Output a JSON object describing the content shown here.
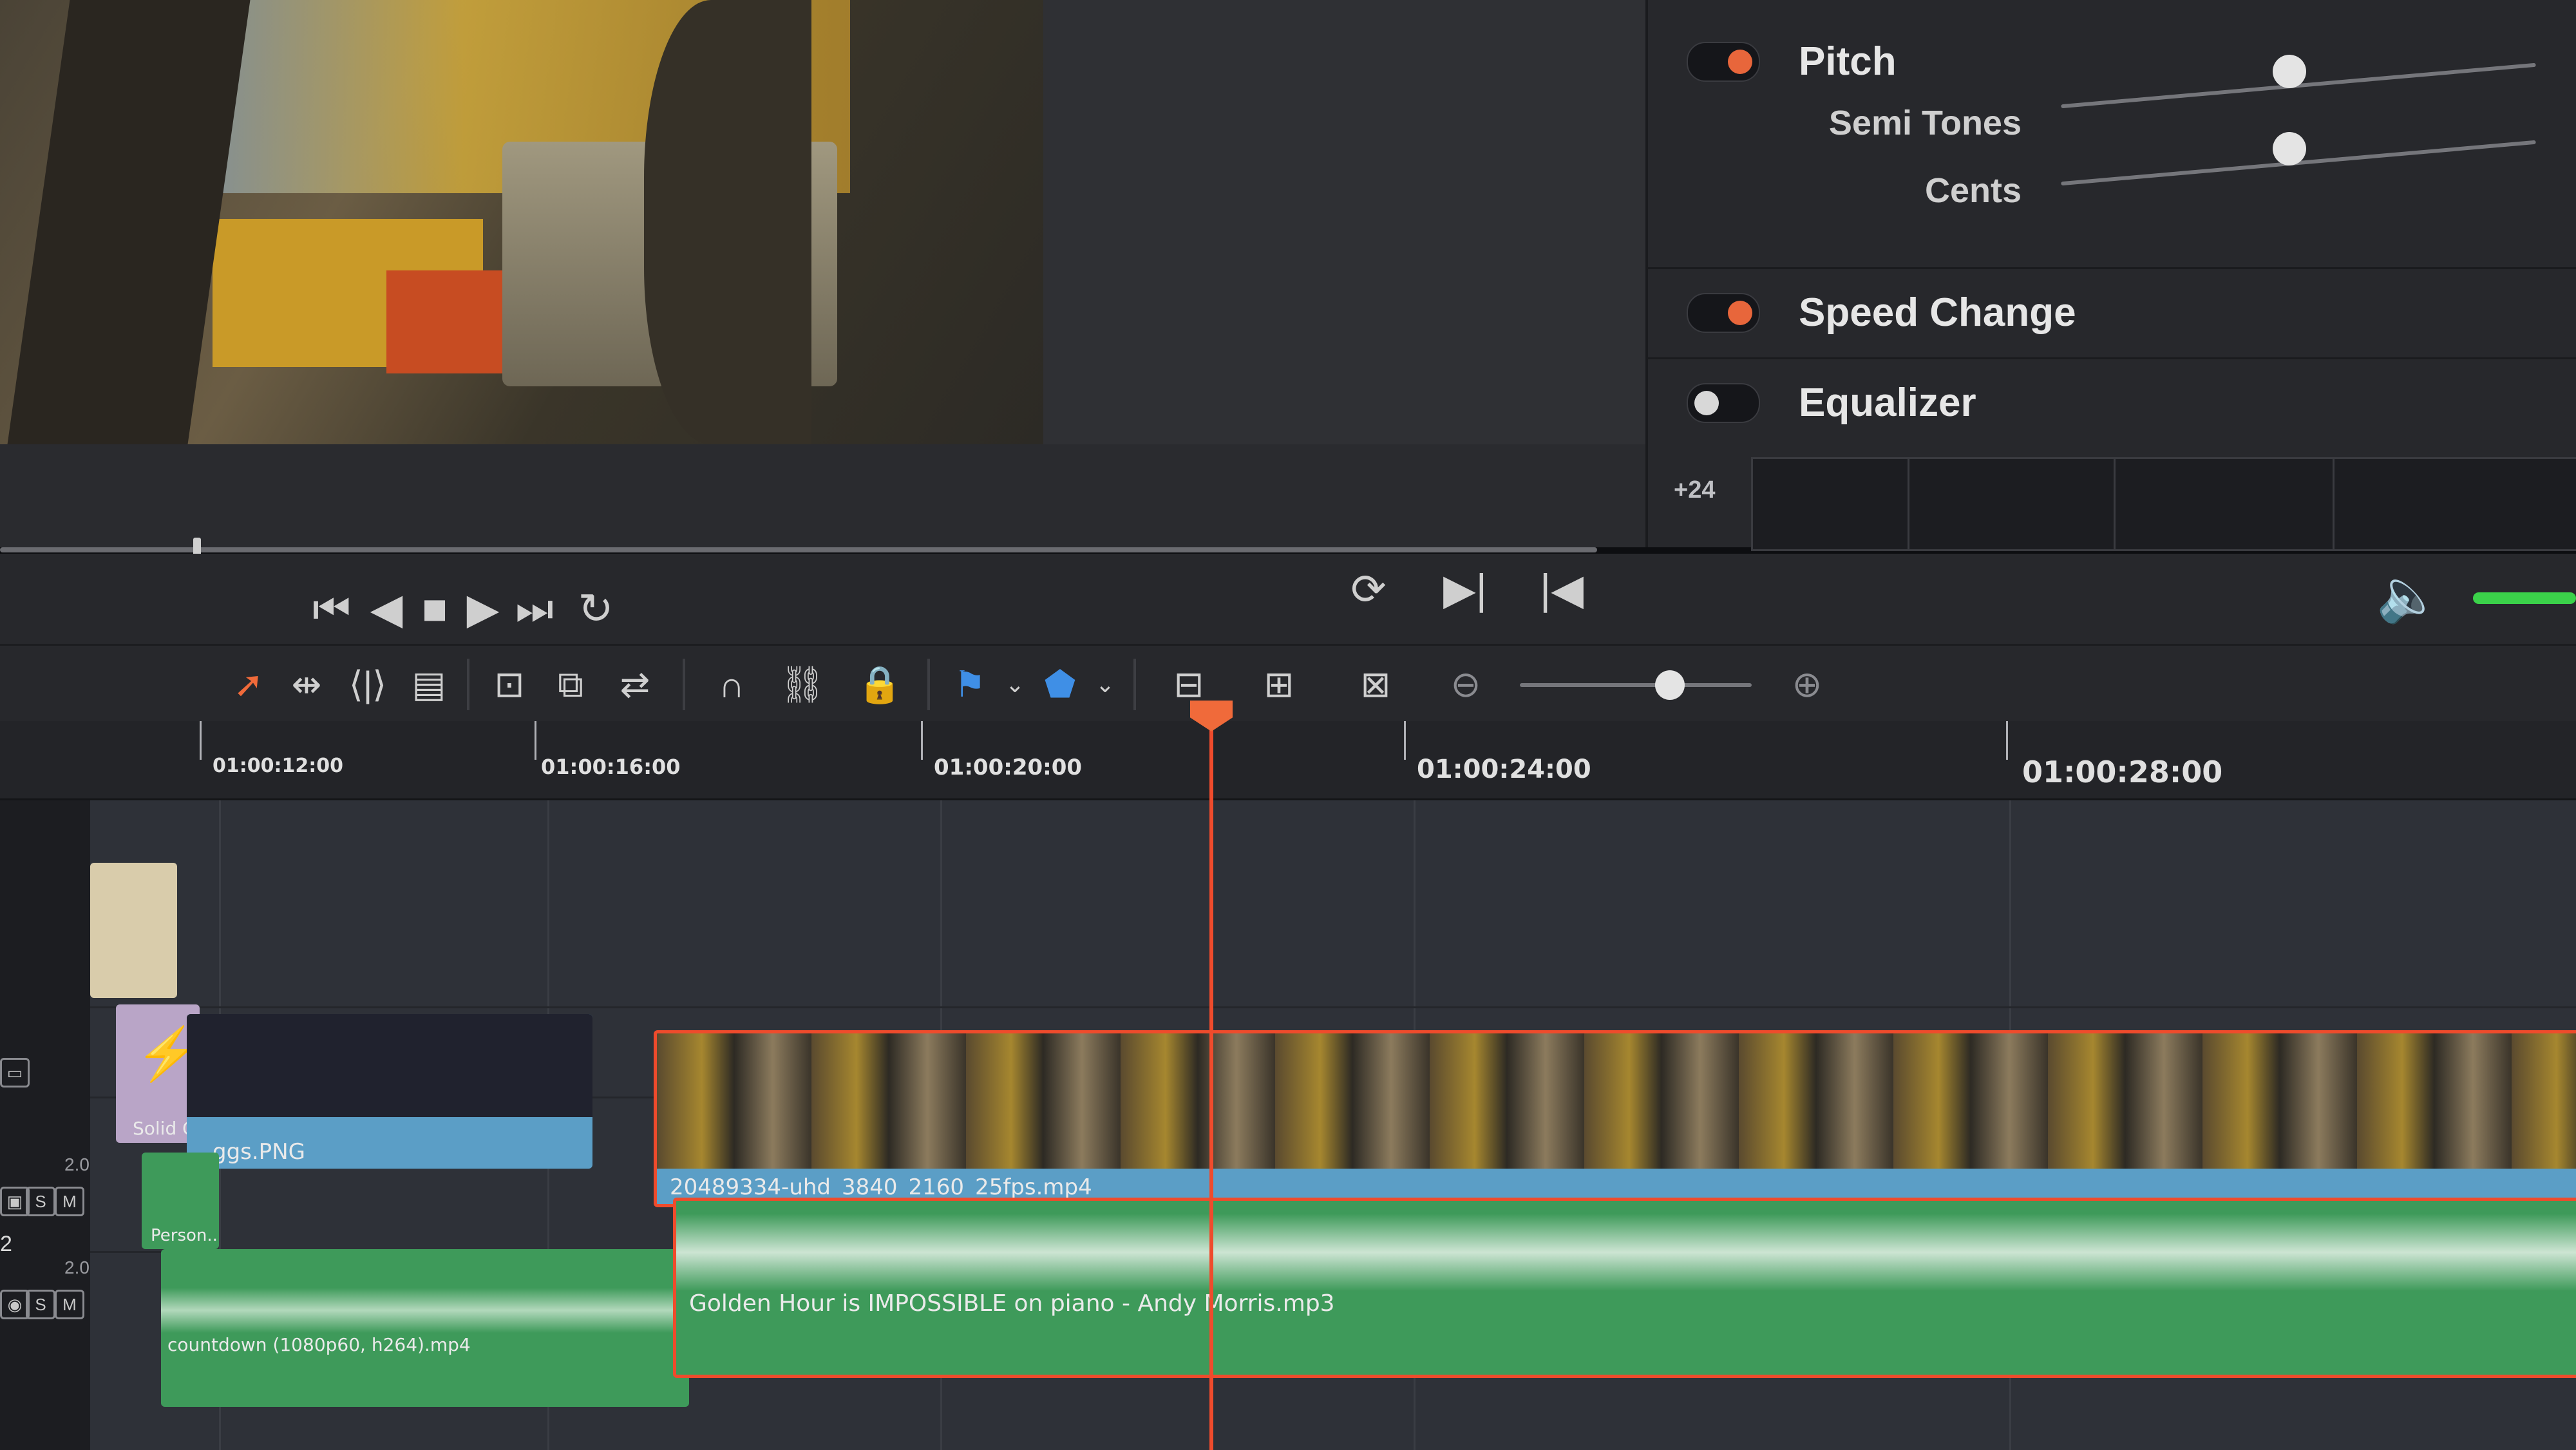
{
  "inspector": {
    "pitch": {
      "label": "Pitch",
      "enabled": true,
      "semi_tones_label": "Semi Tones",
      "cents_label": "Cents"
    },
    "speed_change": {
      "label": "Speed Change",
      "enabled": true
    },
    "equalizer": {
      "label": "Equalizer",
      "enabled": false,
      "db_label": "+24"
    }
  },
  "ruler": {
    "timecodes": [
      "01:00:12:00",
      "01:00:16:00",
      "01:00:20:00",
      "01:00:24:00",
      "01:00:28:00"
    ]
  },
  "clips": {
    "solid_color": "Solid C...",
    "image": "ggs.PNG",
    "video": "20489334-uhd_3840_2160_25fps.mp4",
    "audio_main": "Golden Hour is IMPOSSIBLE on piano - Andy Morris.mp3",
    "audio_countdown": "countdown (1080p60, h264).mp4",
    "person": "Person..."
  },
  "track_headers": {
    "s_label": "S",
    "m_label": "M",
    "level_a1": "2.0",
    "level_a2": "2.0",
    "track_a2_suffix": "2"
  },
  "colors": {
    "accent": "#ef4b2c",
    "video_track": "#5b9ec6",
    "audio_track": "#3e9a5a",
    "solid_color_clip": "#d9ccab",
    "timeline_bg": "#2e3138"
  },
  "icons": [
    "loop-icon",
    "play-forward-frame-icon",
    "previous-clip-icon",
    "skip-start-icon",
    "step-back-icon",
    "stop-icon",
    "play-icon",
    "skip-end-icon",
    "loop-repeat-icon",
    "select-arrow-icon",
    "trim-icon",
    "dynamic-trim-icon",
    "blade-icon",
    "insert-icon",
    "overwrite-icon",
    "replace-icon",
    "snap-icon",
    "link-icon",
    "lock-icon",
    "flag-icon",
    "marker-icon",
    "zoom-fit-icon",
    "zoom-detail-icon",
    "zoom-custom-icon",
    "zoom-out-icon",
    "zoom-in-icon",
    "speaker-icon"
  ]
}
